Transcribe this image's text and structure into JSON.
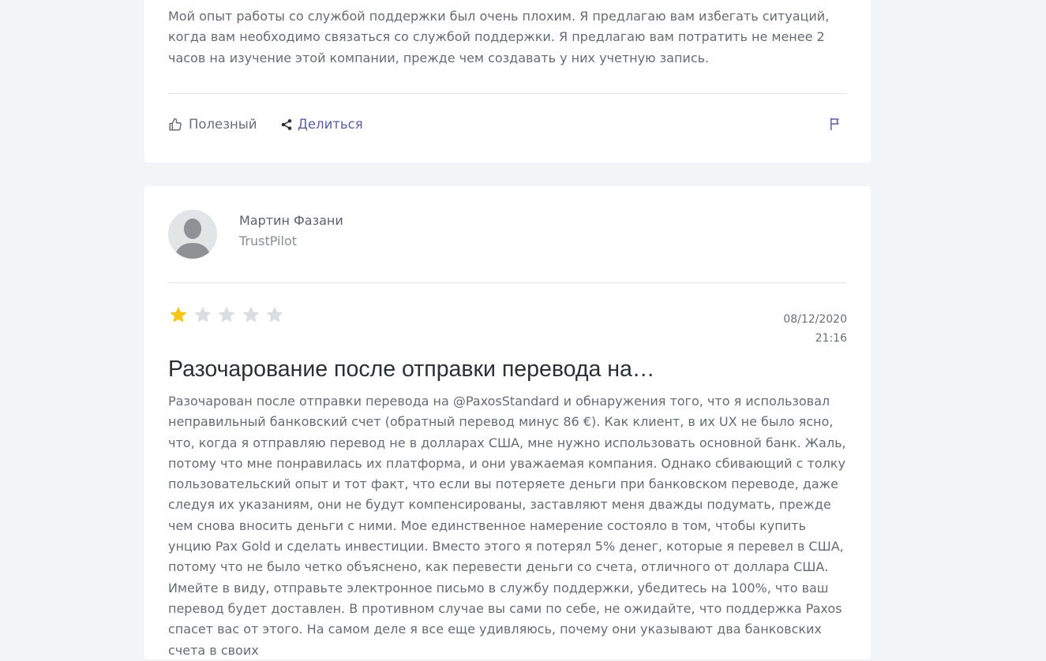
{
  "reviews": [
    {
      "text": "Мой опыт работы со службой поддержки был очень плохим. Я предлагаю вам избегать ситуаций, когда вам необходимо связаться со службой поддержки. Я предлагаю вам потратить не менее 2 часов на изучение этой компании, прежде чем создавать у них учетную запись.",
      "actions": {
        "helpful_label": "Полезный",
        "share_label": "Делиться",
        "flag_icon": "flag-icon"
      }
    },
    {
      "author_name": "Мартин Фазани",
      "source": "TrustPilot",
      "rating": 1,
      "max_rating": 5,
      "date": "08/12/2020",
      "time": "21:16",
      "title": "Разочарование после отправки перевода на…",
      "text": "Разочарован после отправки перевода на @PaxosStandard и обнаружения того, что я использовал неправильный банковский счет (обратный перевод минус 86 €). Как клиент, в их UX не было ясно, что, когда я отправляю перевод не в долларах США, мне нужно использовать основной банк. Жаль, потому что мне понравилась их платформа, и они уважаемая компания. Однако сбивающий с толку пользовательский опыт и тот факт, что если вы потеряете деньги при банковском переводе, даже следуя их указаниям, они не будут компенсированы, заставляют меня дважды подумать, прежде чем снова вносить деньги с ними. Мое единственное намерение состояло в том, чтобы купить унцию Pax Gold и сделать инвестиции. Вместо этого я потерял 5% денег, которые я перевел в США, потому что не было четко объяснено, как перевести деньги со счета, отличного от доллара США. Имейте в виду, отправьте электронное письмо в службу поддержки, убедитесь на 100%, что ваш перевод будет доставлен. В противном случае вы сами по себе, не ожидайте, что поддержка Paxos спасет вас от этого. На самом деле я все еще удивляюсь, почему они указывают два банковских счета в своих"
    }
  ],
  "colors": {
    "page_background": "#f2f4f7",
    "card_background": "#ffffff",
    "text": "#676b70",
    "share_accent": "#5a5fa6",
    "star_filled": "#f5c518",
    "star_empty": "#dcdde0"
  }
}
